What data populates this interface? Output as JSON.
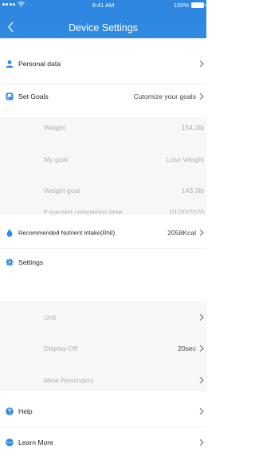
{
  "status_bar": {
    "time": "9:41 AM",
    "battery": "100%"
  },
  "header": {
    "title": "Device Settings"
  },
  "rows": {
    "personal_data": {
      "label": "Personal data"
    },
    "set_goals": {
      "label": "Set Goals",
      "value": "Cutomize your goals"
    },
    "weight": {
      "label": "Weight",
      "value": "154.3lb"
    },
    "my_goal": {
      "label": "My goal",
      "value": "Lose Weight"
    },
    "weight_goal": {
      "label": "Weight goal",
      "value": "143.3lb"
    },
    "completion": {
      "label": "Expected completion time",
      "value": "01/20/2020"
    },
    "rni": {
      "label": "Recommended Nutrient Intake(RNI)",
      "value": "2058Kcal"
    },
    "settings": {
      "label": "Settings"
    },
    "unit": {
      "label": "Unit"
    },
    "display_off": {
      "label": "Display-Off",
      "value": "20sec"
    },
    "meal_reminders": {
      "label": "Meal Reminders"
    },
    "help": {
      "label": "Help"
    },
    "learn_more": {
      "label": "Learn More"
    }
  },
  "colors": {
    "header": "#2e86df",
    "accent": "#2f8ae2",
    "muted_text": "#b0b0b0",
    "separator": "#eeeeee"
  }
}
